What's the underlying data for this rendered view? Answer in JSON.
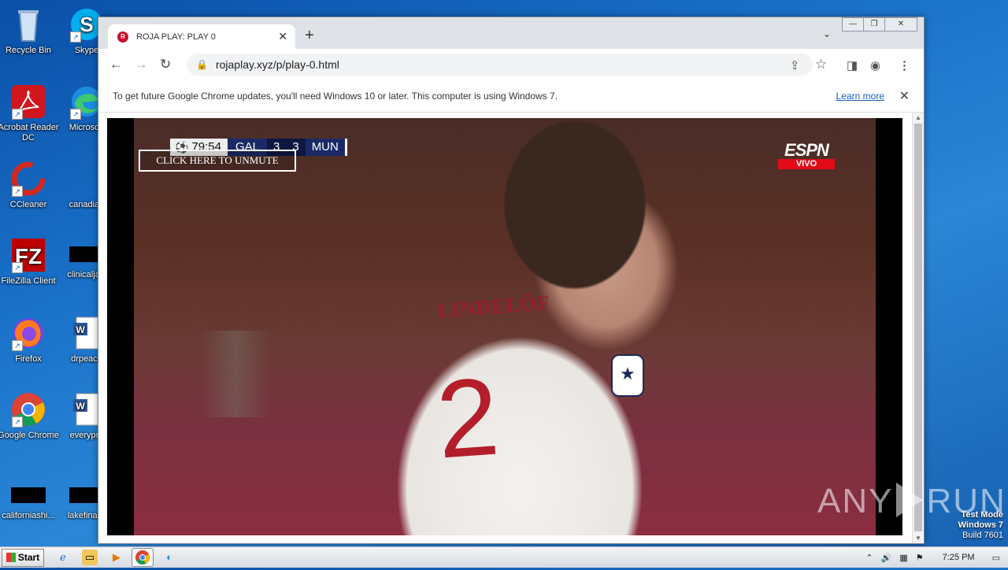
{
  "desktop": {
    "icons": [
      {
        "label": "Recycle Bin"
      },
      {
        "label": "Skype"
      },
      {
        "label": "Acrobat Reader DC"
      },
      {
        "label": "Microsoft"
      },
      {
        "label": "CCleaner"
      },
      {
        "label": "canadian"
      },
      {
        "label": "FileZilla Client"
      },
      {
        "label": "clinicaljacl"
      },
      {
        "label": "Firefox"
      },
      {
        "label": "drpeace"
      },
      {
        "label": "Google Chrome"
      },
      {
        "label": "everypre"
      },
      {
        "label": "californiashi..."
      },
      {
        "label": "lakefinally"
      }
    ],
    "watermark": {
      "left": "ANY",
      "right": "RUN"
    },
    "testmode": {
      "line1": "Test Mode",
      "line2": "Windows 7",
      "line3": "Build 7601"
    }
  },
  "browser": {
    "tab_title": "ROJA PLAY: PLAY 0",
    "tab_close": "✕",
    "new_tab": "+",
    "tab_dropdown": "⌄",
    "window_buttons": {
      "minimize": "—",
      "maximize": "❐",
      "close": "✕"
    },
    "url": "rojaplay.xyz/p/play-0.html",
    "infobar": {
      "message": "To get future Google Chrome updates, you'll need Windows 10 or later. This computer is using Windows 7.",
      "link": "Learn more",
      "close": "✕"
    }
  },
  "video": {
    "scorebug": {
      "time": "79:54",
      "team_a": "GAL",
      "score_a": "3",
      "score_b": "3",
      "team_b": "MUN"
    },
    "unmute_label": "CLICK HERE TO UNMUTE",
    "broadcaster": "ESPN",
    "live_label": "VIVO",
    "jersey_name": "LINDELÖF",
    "jersey_number": "2"
  },
  "taskbar": {
    "start_label": "Start",
    "clock": "7:25 PM"
  }
}
